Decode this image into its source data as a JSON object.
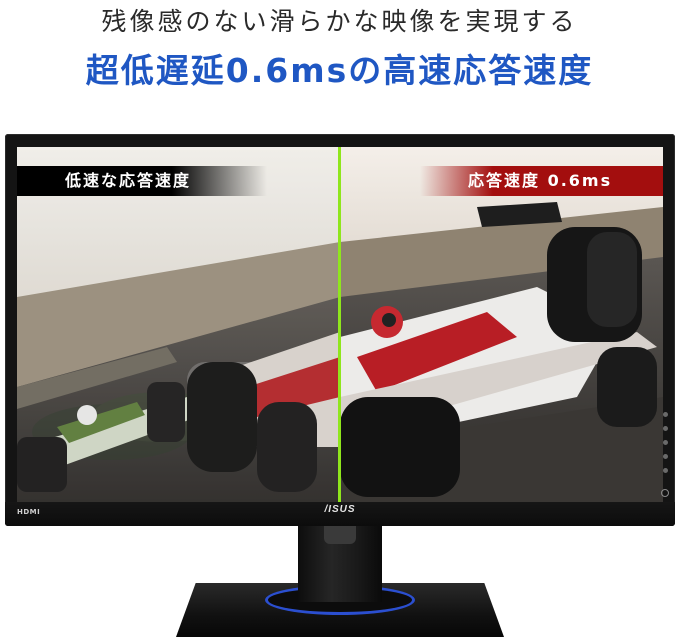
{
  "headline": {
    "line1": "残像感のない滑らかな映像を実現する",
    "line2": "超低遅延0.6msの高速応答速度"
  },
  "screen": {
    "label_left": "低速な応答速度",
    "label_right": "応答速度 0.6ms"
  },
  "monitor": {
    "input_logo": "HDMI",
    "brand_logo": "/ISUS"
  },
  "colors": {
    "headline_accent": "#1f57c3",
    "divider_line": "#8fe61c",
    "label_right_bg": "#a30e0e",
    "stand_ring": "#2b4fd0"
  }
}
